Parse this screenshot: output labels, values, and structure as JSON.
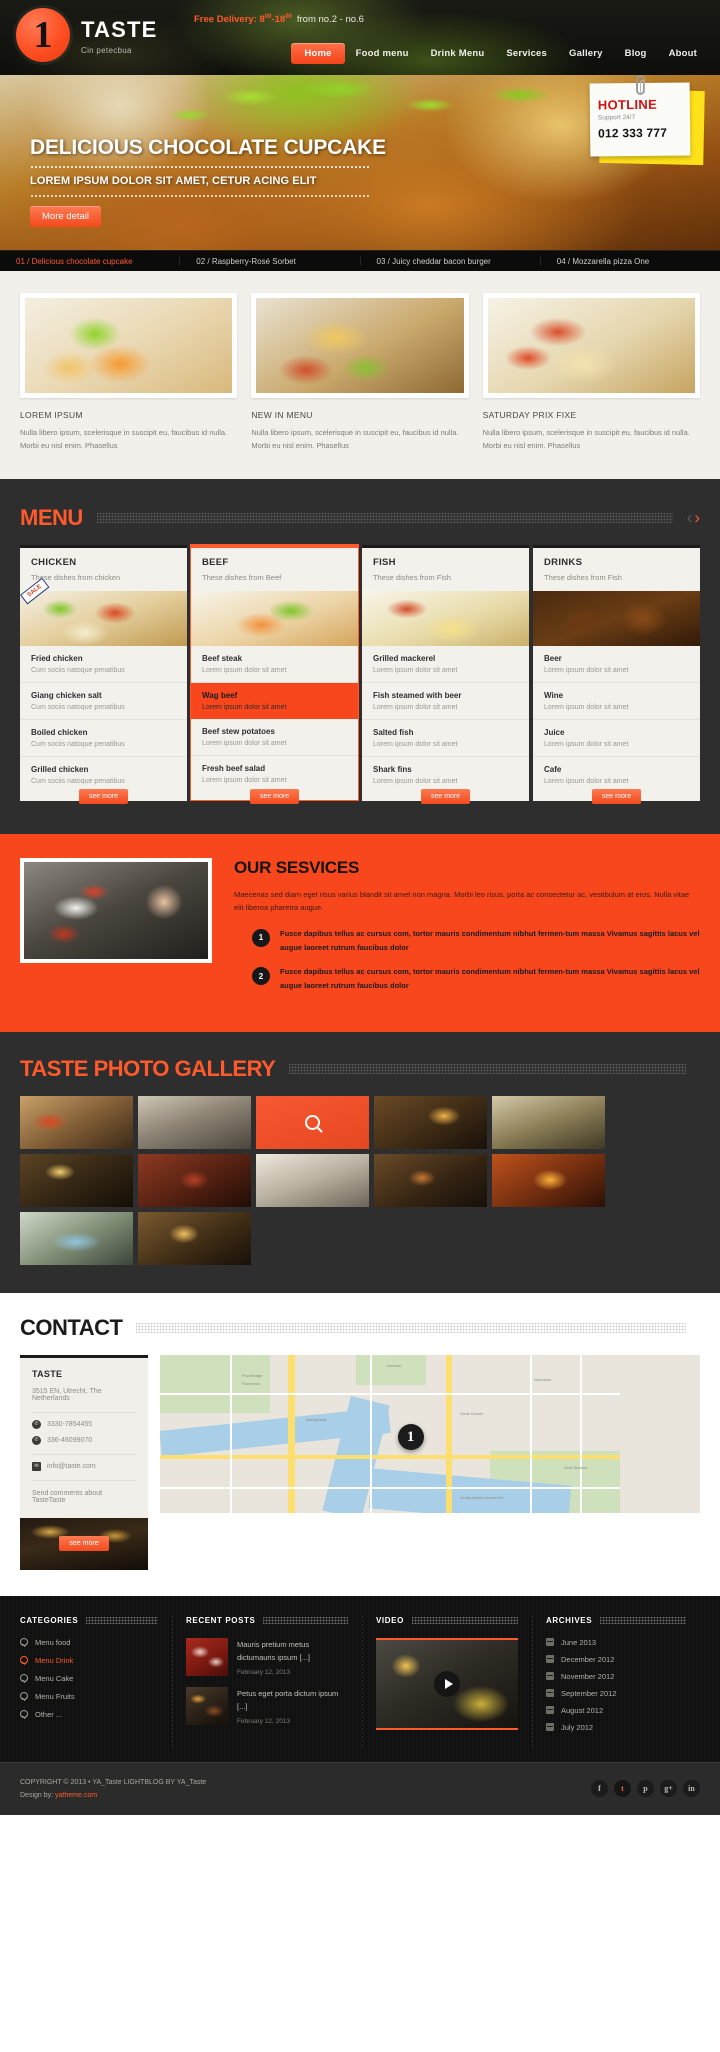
{
  "header": {
    "logo": {
      "mark": "1",
      "title": "TASTE",
      "subtitle": "Cin petecbua"
    },
    "delivery": {
      "label": "Free Delivery: 8",
      "sup1": "00",
      "mid": "-18",
      "sup2": "00",
      "plain": "from no.2 - no.6"
    },
    "nav": [
      {
        "label": "Home",
        "active": true
      },
      {
        "label": "Food menu",
        "active": false
      },
      {
        "label": "Drink Menu",
        "active": false
      },
      {
        "label": "Services",
        "active": false
      },
      {
        "label": "Gallery",
        "active": false
      },
      {
        "label": "Blog",
        "active": false
      },
      {
        "label": "About",
        "active": false
      }
    ]
  },
  "hero": {
    "title": "DELICIOUS CHOCOLATE CUPCAKE",
    "subtitle": "LOREM IPSUM DOLOR SIT AMET, CETUR ACING ELIT",
    "button": "More detail",
    "hotline": {
      "title": "HOTLINE",
      "support": "Support 24/7",
      "number": "012 333 777"
    },
    "slides": [
      {
        "label": "01 / Delicious chocolate cupcake",
        "active": true
      },
      {
        "label": "02 / Raspberry-Rosé Sorbet",
        "active": false
      },
      {
        "label": "03 / Juicy cheddar bacon burger",
        "active": false
      },
      {
        "label": "04 / Mozzarella pizza One",
        "active": false
      }
    ]
  },
  "features": [
    {
      "title": "LOREM IPSUM",
      "text": "Nulla libero ipsum, scelerisque in suscipit eu, faucibus id nulla. Morbi eu nisl enim. Phasellus"
    },
    {
      "title": "NEW IN MENU",
      "text": "Nulla libero ipsum, scelerisque in suscipit eu, faucibus id nulla. Morbi eu nisl enim. Phasellus"
    },
    {
      "title": "SATURDAY PRIX FIXE",
      "text": "Nulla libero ipsum, scelerisque in suscipit eu, faucibus id nulla. Morbi eu nisl enim. Phasellus"
    }
  ],
  "menu": {
    "heading": "MENU",
    "see_more": "see more",
    "sale_tag": "SALE",
    "cards": [
      {
        "title": "CHICKEN",
        "desc": "These dishes from chicken",
        "active": false,
        "has_sale": true,
        "items": [
          {
            "name": "Fried chicken",
            "desc": "Cum sociis natoque penatibus",
            "hot": false
          },
          {
            "name": "Giang chicken salt",
            "desc": "Cum sociis natoque penatibus",
            "hot": false
          },
          {
            "name": "Boiled chicken",
            "desc": "Cum sociis natoque penatibus",
            "hot": false
          },
          {
            "name": "Grilled chicken",
            "desc": "Cum sociis natoque penatibus",
            "hot": false
          }
        ]
      },
      {
        "title": "BEEF",
        "desc": "These dishes from Beef",
        "active": true,
        "has_sale": false,
        "items": [
          {
            "name": "Beef steak",
            "desc": "Lorem ipsum dolor sit amet",
            "hot": false
          },
          {
            "name": "Wag beef",
            "desc": "Lorem ipsum dolor sit amet",
            "hot": true
          },
          {
            "name": "Beef stew potatoes",
            "desc": "Lorem ipsum dolor sit amet",
            "hot": false
          },
          {
            "name": "Fresh beef salad",
            "desc": "Lorem ipsum dolor sit amet",
            "hot": false
          }
        ]
      },
      {
        "title": "FISH",
        "desc": "These dishes from Fish",
        "active": false,
        "has_sale": false,
        "items": [
          {
            "name": "Grilled mackerel",
            "desc": "Lorem ipsum dolor sit amet",
            "hot": false
          },
          {
            "name": "Fish steamed with beer",
            "desc": "Lorem ipsum dolor sit amet",
            "hot": false
          },
          {
            "name": "Salted fish",
            "desc": "Lorem ipsum dolor sit amet",
            "hot": false
          },
          {
            "name": "Shark fins",
            "desc": "Lorem ipsum dolor sit amet",
            "hot": false
          }
        ]
      },
      {
        "title": "DRINKS",
        "desc": "These dishes from Fish",
        "active": false,
        "has_sale": false,
        "items": [
          {
            "name": "Beer",
            "desc": "Lorem ipsum dolor sit amet",
            "hot": false
          },
          {
            "name": "Wine",
            "desc": "Lorem ipsum dolor sit amet",
            "hot": false
          },
          {
            "name": "Juice",
            "desc": "Lorem ipsum dolor sit amet",
            "hot": false
          },
          {
            "name": "Cafe",
            "desc": "Lorem ipsum dolor sit amet",
            "hot": false
          }
        ]
      }
    ]
  },
  "services": {
    "title": "OUR SESVICES",
    "intro": "Maecenas sed diam eget risus varius blandit sit amet non magna. Morbi leo risus, porta ac consectetur ac, vestibulum at eros. Nulla vitae elit liberoa pharetra augue.",
    "items": [
      {
        "num": "1",
        "text": "Fusce dapibus tellus ac cursus com, tortor mauris condimentum nibhut fermen-tum massa Vivamus sagittis lacus vel augue laoreet rutrum faucibus dolor"
      },
      {
        "num": "2",
        "text": "Fusce dapibus tellus ac cursus com, tortor mauris condimentum nibhut fermen-tum massa Vivamus sagittis lacus vel augue laoreet rutrum faucibus dolor"
      }
    ]
  },
  "gallery": {
    "heading": "TASTE PHOTO GALLERY",
    "cell_count": 12,
    "highlighted_index": 2
  },
  "contact": {
    "heading": "CONTACT",
    "name": "TASTE",
    "address": "3515 EN, Utrecht, The Netherlands",
    "phone1": "3330-7854455",
    "phone2": "336-46099070",
    "email": "info@taste.com",
    "note": "Send comments about TasteTaste",
    "photo_button": "see more",
    "map_pin": "1",
    "map_labels": [
      "Pozenhage",
      "Pozenbos",
      "Marktplaats",
      "Centrum",
      "Oude Gracht",
      "Noordzee",
      "W Marktplein Access Rd",
      "Oost Stadion"
    ]
  },
  "footer": {
    "categories": {
      "heading": "CATEGORIES",
      "items": [
        {
          "label": "Menu food",
          "active": false
        },
        {
          "label": "Menu Drink",
          "active": true
        },
        {
          "label": "Menu Cake",
          "active": false
        },
        {
          "label": "Menu Fruits",
          "active": false
        },
        {
          "label": "Other ...",
          "active": false
        }
      ]
    },
    "recent_posts": {
      "heading": "RECENT POSTS",
      "items": [
        {
          "title": "Mauris pretium metus dictumauris ipsum [...]",
          "date": "February 12, 2013"
        },
        {
          "title": "Petus eget porta dictum ipsum [...]",
          "date": "February 12, 2013"
        }
      ]
    },
    "video": {
      "heading": "VIDEO"
    },
    "archives": {
      "heading": "ARCHIVES",
      "items": [
        "June 2013",
        "December 2012",
        "November 2012",
        "September 2012",
        "August 2012",
        "July 2012"
      ]
    }
  },
  "copyright": {
    "line1": "COPYRIGHT © 2013  •  YA_Taste LIGHTBLOG BY YA_Taste",
    "line2_prefix": "Design by:",
    "line2_link": "yatheme.com",
    "socials": [
      "f",
      "t",
      "p",
      "g+",
      "in"
    ]
  },
  "colors": {
    "accent": "#ff5a2b",
    "accent_strong": "#f9471d",
    "dark": "#2e2e2e",
    "footer": "#111111"
  }
}
